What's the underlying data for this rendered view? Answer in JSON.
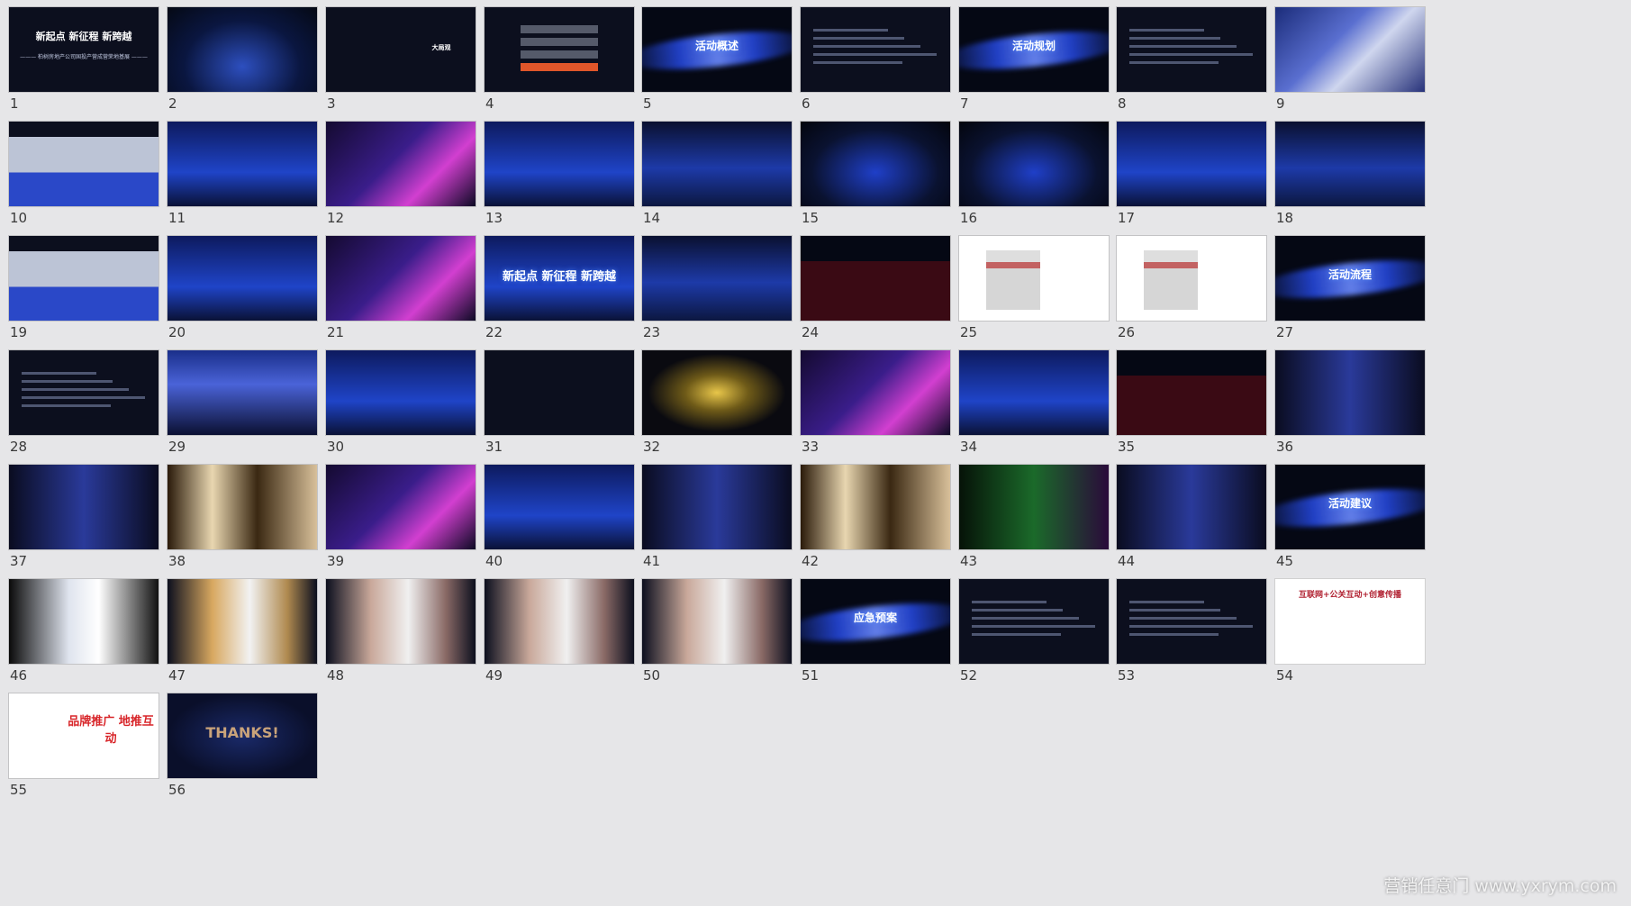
{
  "slides": [
    {
      "number": "1",
      "style": "dark",
      "title": "新起点 新征程 新跨越",
      "subtitle": "——— 柏树房地产公司国投产营成营荣地基展 ———"
    },
    {
      "number": "2",
      "style": "space"
    },
    {
      "number": "3",
      "style": "dark",
      "title": "大局观"
    },
    {
      "number": "4",
      "style": "menu"
    },
    {
      "number": "5",
      "style": "wave",
      "title": "活动概述"
    },
    {
      "number": "6",
      "style": "text"
    },
    {
      "number": "7",
      "style": "wave",
      "title": "活动规划"
    },
    {
      "number": "8",
      "style": "text"
    },
    {
      "number": "9",
      "style": "photo"
    },
    {
      "number": "10",
      "style": "hall"
    },
    {
      "number": "11",
      "style": "blue"
    },
    {
      "number": "12",
      "style": "purple"
    },
    {
      "number": "13",
      "style": "blue"
    },
    {
      "number": "14",
      "style": "stage"
    },
    {
      "number": "15",
      "style": "arch"
    },
    {
      "number": "16",
      "style": "arch"
    },
    {
      "number": "17",
      "style": "blue"
    },
    {
      "number": "18",
      "style": "stage"
    },
    {
      "number": "19",
      "style": "hall"
    },
    {
      "number": "20",
      "style": "blue"
    },
    {
      "number": "21",
      "style": "purple"
    },
    {
      "number": "22",
      "style": "blue",
      "title": "新起点 新征程 新跨越"
    },
    {
      "number": "23",
      "style": "stage"
    },
    {
      "number": "24",
      "style": "red"
    },
    {
      "number": "25",
      "style": "white"
    },
    {
      "number": "26",
      "style": "white"
    },
    {
      "number": "27",
      "style": "wave",
      "title": "活动流程"
    },
    {
      "number": "28",
      "style": "text"
    },
    {
      "number": "29",
      "style": "night"
    },
    {
      "number": "30",
      "style": "blue"
    },
    {
      "number": "31",
      "style": "dark"
    },
    {
      "number": "32",
      "style": "gold"
    },
    {
      "number": "33",
      "style": "purple"
    },
    {
      "number": "34",
      "style": "blue"
    },
    {
      "number": "35",
      "style": "red"
    },
    {
      "number": "36",
      "style": "show"
    },
    {
      "number": "37",
      "style": "show"
    },
    {
      "number": "38",
      "style": "sepia"
    },
    {
      "number": "39",
      "style": "purple"
    },
    {
      "number": "40",
      "style": "blue"
    },
    {
      "number": "41",
      "style": "show"
    },
    {
      "number": "42",
      "style": "sepia"
    },
    {
      "number": "43",
      "style": "green"
    },
    {
      "number": "44",
      "style": "show"
    },
    {
      "number": "45",
      "style": "wave",
      "title": "活动建议"
    },
    {
      "number": "46",
      "style": "cam"
    },
    {
      "number": "47",
      "style": "flower"
    },
    {
      "number": "48",
      "style": "model"
    },
    {
      "number": "49",
      "style": "model"
    },
    {
      "number": "50",
      "style": "model"
    },
    {
      "number": "51",
      "style": "wave",
      "title": "应急预案"
    },
    {
      "number": "52",
      "style": "text"
    },
    {
      "number": "53",
      "style": "text"
    },
    {
      "number": "54",
      "style": "white-red",
      "title": "互联网+公关互动+创意传播"
    },
    {
      "number": "55",
      "style": "map",
      "title": "品牌推广 地推互动"
    },
    {
      "number": "56",
      "style": "thanks",
      "title": "THANKS!"
    }
  ],
  "watermark": "营销任意门 www.yxrym.com"
}
